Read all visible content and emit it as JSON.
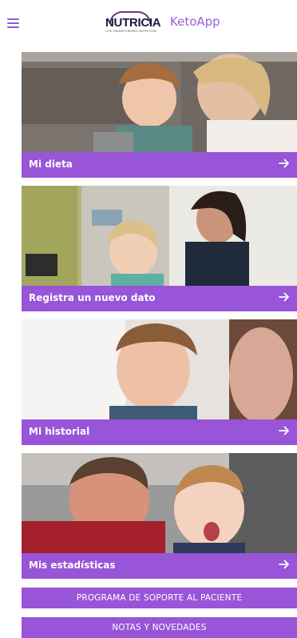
{
  "header": {
    "menu_icon": "hamburger-menu-icon",
    "logo_word": "NUTRICIA",
    "logo_tagline": "LIFE-TRANSFORMING NUTRITION",
    "app_name": "KetoApp"
  },
  "cards": [
    {
      "label": "Mi dieta",
      "icon": "arrow-right-icon"
    },
    {
      "label": "Registra un nuevo dato",
      "icon": "arrow-right-icon"
    },
    {
      "label": "Mi historial",
      "icon": "arrow-right-icon"
    },
    {
      "label": "Mis estadísticas",
      "icon": "arrow-right-icon"
    }
  ],
  "buttons": {
    "support_program": "PROGRAMA DE SOPORTE AL PACIENTE",
    "news": "NOTAS Y NOVEDADES"
  },
  "colors": {
    "accent": "#9855d8",
    "logo_dark": "#1f1a3c",
    "logo_arc": "#7a2e8f",
    "app_name": "#9a5fd6"
  }
}
